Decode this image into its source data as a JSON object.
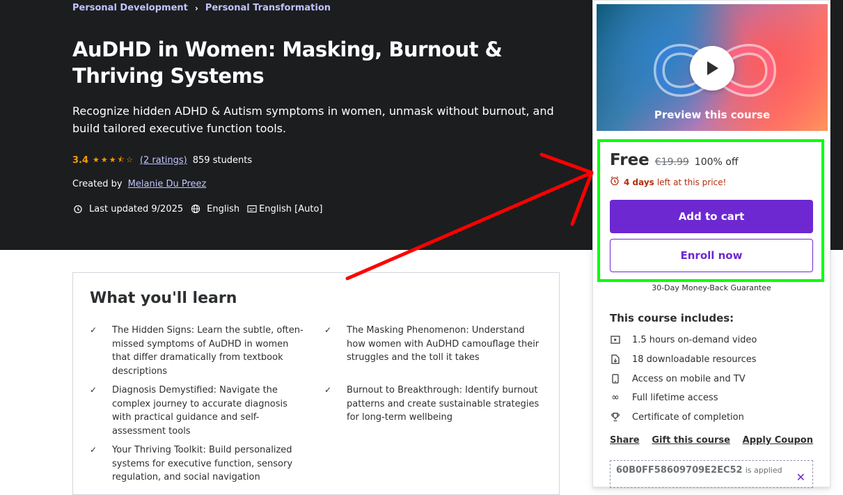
{
  "breadcrumb": {
    "items": [
      "Personal Development",
      "Personal Transformation"
    ]
  },
  "course": {
    "title": "AuDHD in Women: Masking, Burnout & Thriving Systems",
    "subtitle": "Recognize hidden ADHD & Autism symptoms in women, unmask without burnout, and build tailored executive function tools.",
    "rating": "3.4",
    "stars_value": 3.5,
    "ratings_link": "(2 ratings)",
    "students": "859 students",
    "created_by_label": "Created by",
    "author": "Melanie Du Preez",
    "last_updated": "Last updated 9/2025",
    "language": "English",
    "captions": "English [Auto]"
  },
  "learn": {
    "title": "What you'll learn",
    "items": [
      "The Hidden Signs: Learn the subtle, often-missed symptoms of AuDHD in women that differ dramatically from textbook descriptions",
      "The Masking Phenomenon: Understand how women with AuDHD camouflage their struggles and the toll it takes",
      "Diagnosis Demystified: Navigate the complex journey to accurate diagnosis with practical guidance and self-assessment tools",
      "Burnout to Breakthrough: Identify burnout patterns and create sustainable strategies for long-term wellbeing",
      "Your Thriving Toolkit: Build personalized systems for executive function, sensory regulation, and social navigation"
    ]
  },
  "sidebar": {
    "preview_label": "Preview this course",
    "price": "Free",
    "original_price": "€19.99",
    "discount": "100% off",
    "timer_bold": "4 days",
    "timer_rest": "left at this price!",
    "add_to_cart": "Add to cart",
    "enroll_now": "Enroll now",
    "guarantee": "30-Day Money-Back Guarantee",
    "includes_title": "This course includes:",
    "includes": [
      "1.5 hours on-demand video",
      "18 downloadable resources",
      "Access on mobile and TV",
      "Full lifetime access",
      "Certificate of completion"
    ],
    "share": "Share",
    "gift": "Gift this course",
    "apply_coupon": "Apply Coupon",
    "coupon_code": "60B0FF58609709E2EC52",
    "coupon_applied": "is applied"
  },
  "colors": {
    "accent": "#6d28d2",
    "hero_bg": "#1c1d1f",
    "rating": "#f69c08",
    "link": "#c0c4fc",
    "timer": "#b32d0f",
    "highlight_box": "#00ff00",
    "annotation_arrow": "#ff0000"
  },
  "icons": {
    "breadcrumb_separator": "chevron-right-icon",
    "last_updated": "alarm-icon",
    "language": "globe-icon",
    "captions": "captions-icon",
    "timer": "alarm-clock-icon",
    "check": "check-icon",
    "preview": "play-icon",
    "includes": [
      "video-icon",
      "file-download-icon",
      "mobile-icon",
      "infinity-icon",
      "trophy-icon"
    ],
    "coupon_remove": "close-icon"
  }
}
